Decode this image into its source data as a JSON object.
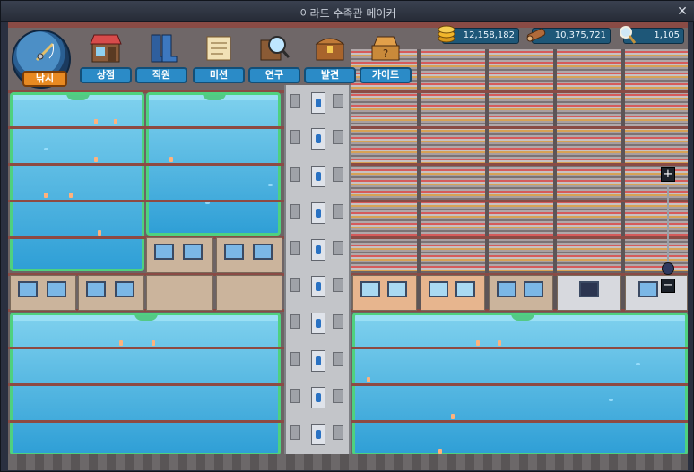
{
  "window": {
    "title": "이라드 수족관 메이커",
    "close_glyph": "✕"
  },
  "menu": {
    "fishing_label": "낚시",
    "items": [
      {
        "id": "shop",
        "label": "상점",
        "icon": "shop-icon"
      },
      {
        "id": "staff",
        "label": "직원",
        "icon": "boots-icon"
      },
      {
        "id": "mission",
        "label": "미션",
        "icon": "scroll-icon"
      },
      {
        "id": "research",
        "label": "연구",
        "icon": "magnifier-book-icon"
      },
      {
        "id": "discovery",
        "label": "발견",
        "icon": "chest-icon"
      },
      {
        "id": "guide",
        "label": "가이드",
        "icon": "question-chest-icon"
      }
    ]
  },
  "resources": [
    {
      "id": "gold",
      "value": "12,158,182",
      "icon": "coin-stack-icon",
      "color": "#f0b62b"
    },
    {
      "id": "wood",
      "value": "10,375,721",
      "icon": "wood-log-icon",
      "color": "#b06a3a"
    },
    {
      "id": "research",
      "value": "1,105",
      "icon": "magnifier-icon",
      "color": "#dfe8f0"
    }
  ],
  "zoom": {
    "plus": "+",
    "minus": "−"
  },
  "colors": {
    "tank_border": "#4fd17f",
    "water_top": "#7fd1ee",
    "water_bottom": "#2f9fd6",
    "menu_label_bg": "#2b8bc7",
    "fishing_label_bg": "#e88a22"
  }
}
